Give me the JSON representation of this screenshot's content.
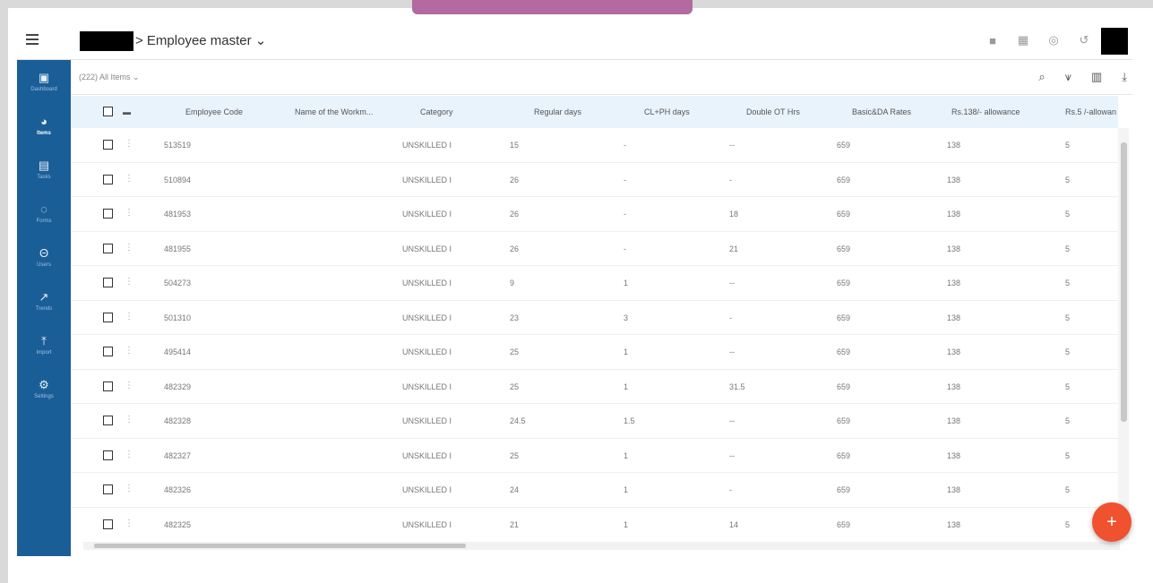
{
  "header": {
    "breadcrumb": "> Employee master ⌄",
    "icons": [
      "lock-icon",
      "grid-icon",
      "help-icon",
      "history-icon"
    ]
  },
  "sidebar": {
    "items": [
      {
        "icon": "dashboard-icon",
        "label": "Dashboard",
        "active": false
      },
      {
        "icon": "items-icon",
        "label": "Items",
        "active": true
      },
      {
        "icon": "tasks-icon",
        "label": "Tasks",
        "active": false
      },
      {
        "icon": "forms-icon",
        "label": "Forms",
        "active": false
      },
      {
        "icon": "users-icon",
        "label": "Users",
        "active": false
      },
      {
        "icon": "trends-icon",
        "label": "Trends",
        "active": false
      },
      {
        "icon": "import-icon",
        "label": "Import",
        "active": false
      },
      {
        "icon": "settings-icon",
        "label": "Settings",
        "active": false
      }
    ]
  },
  "toolbar": {
    "items_label": "(222) All Items ⌄"
  },
  "table": {
    "columns": [
      "Employee Code",
      "Name of the Workm...",
      "Category",
      "Regular days",
      "CL+PH days",
      "Double OT Hrs",
      "Basic&DA Rates",
      "Rs.138/- allowance",
      "Rs.5 /-allowan"
    ],
    "rows": [
      [
        "513519",
        "",
        "UNSKILLED I",
        "15",
        "-",
        "--",
        "659",
        "138",
        "5"
      ],
      [
        "510894",
        "",
        "UNSKILLED I",
        "26",
        "-",
        "-",
        "659",
        "138",
        "5"
      ],
      [
        "481953",
        "",
        "UNSKILLED I",
        "26",
        "-",
        "18",
        "659",
        "138",
        "5"
      ],
      [
        "481955",
        "",
        "UNSKILLED I",
        "26",
        "-",
        "21",
        "659",
        "138",
        "5"
      ],
      [
        "504273",
        "",
        "UNSKILLED I",
        "9",
        "1",
        "--",
        "659",
        "138",
        "5"
      ],
      [
        "501310",
        "",
        "UNSKILLED I",
        "23",
        "3",
        "-",
        "659",
        "138",
        "5"
      ],
      [
        "495414",
        "",
        "UNSKILLED I",
        "25",
        "1",
        "--",
        "659",
        "138",
        "5"
      ],
      [
        "482329",
        "",
        "UNSKILLED I",
        "25",
        "1",
        "31.5",
        "659",
        "138",
        "5"
      ],
      [
        "482328",
        "",
        "UNSKILLED I",
        "24.5",
        "1.5",
        "--",
        "659",
        "138",
        "5"
      ],
      [
        "482327",
        "",
        "UNSKILLED I",
        "25",
        "1",
        "--",
        "659",
        "138",
        "5"
      ],
      [
        "482326",
        "",
        "UNSKILLED I",
        "24",
        "1",
        "-",
        "659",
        "138",
        "5"
      ],
      [
        "482325",
        "",
        "UNSKILLED I",
        "21",
        "1",
        "14",
        "659",
        "138",
        "5"
      ]
    ]
  },
  "fab": {
    "label": "+"
  },
  "colors": {
    "sidebar": "#1a5e98",
    "header_row": "#e9f3fb",
    "fab": "#f0512f",
    "top_tab": "#b36aa0"
  }
}
